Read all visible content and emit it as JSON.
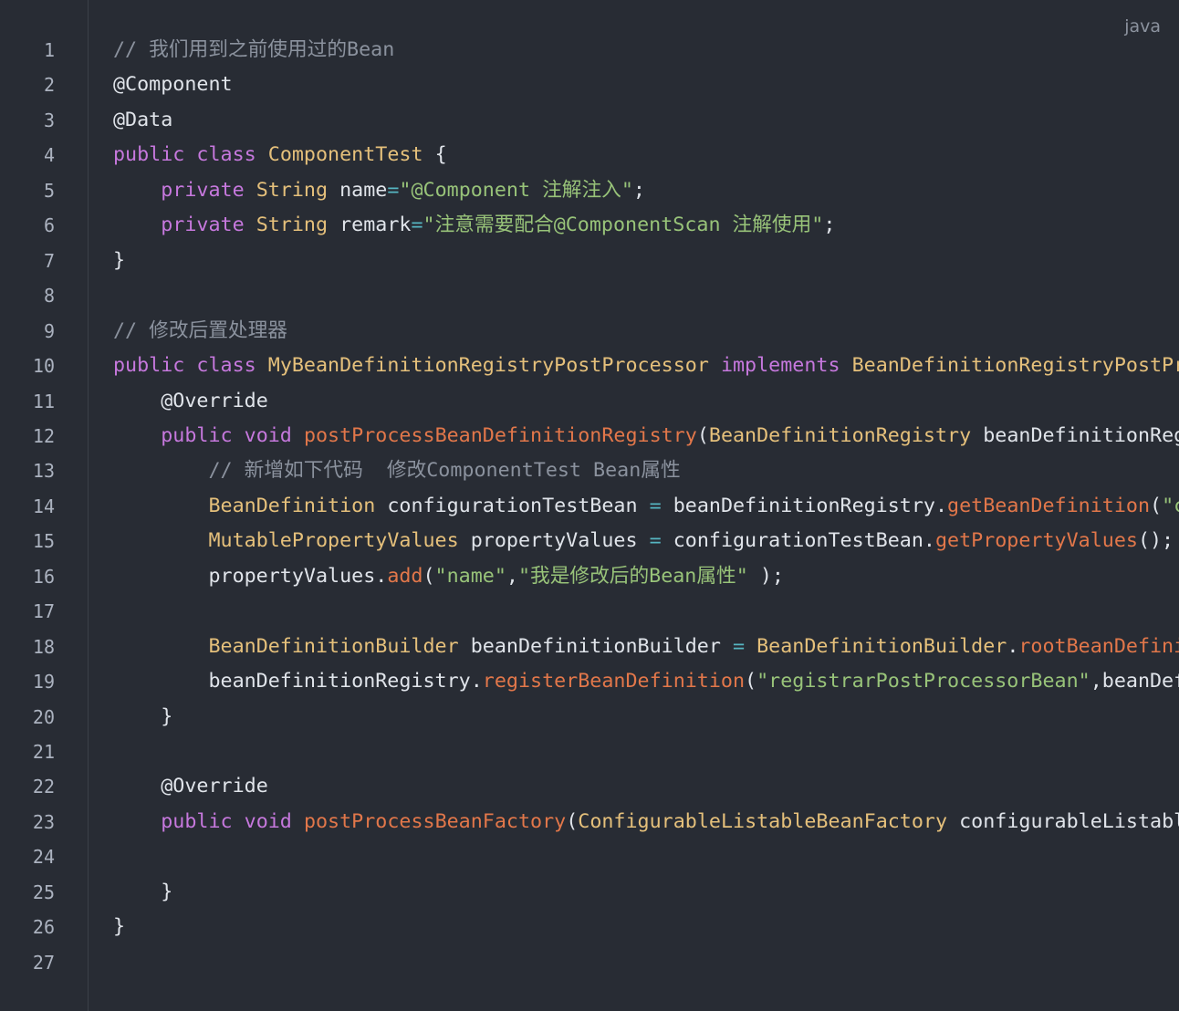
{
  "language_label": "java",
  "colors": {
    "background": "#282c34",
    "comment": "#8b929e",
    "keyword": "#c678dd",
    "class": "#e5c07b",
    "string": "#98c379",
    "function": "#e2774a",
    "operator": "#56b6c2",
    "plain": "#e0e4ea"
  },
  "lines": [
    {
      "num": "1",
      "tokens": [
        {
          "t": "comment",
          "v": "// 我们用到之前使用过的Bean"
        }
      ]
    },
    {
      "num": "2",
      "tokens": [
        {
          "t": "anno",
          "v": "@Component"
        }
      ]
    },
    {
      "num": "3",
      "tokens": [
        {
          "t": "anno",
          "v": "@Data"
        }
      ]
    },
    {
      "num": "4",
      "tokens": [
        {
          "t": "keyword",
          "v": "public"
        },
        {
          "t": "plain",
          "v": " "
        },
        {
          "t": "keyword",
          "v": "class"
        },
        {
          "t": "plain",
          "v": " "
        },
        {
          "t": "class",
          "v": "ComponentTest"
        },
        {
          "t": "plain",
          "v": " {"
        }
      ]
    },
    {
      "num": "5",
      "tokens": [
        {
          "t": "plain",
          "v": "    "
        },
        {
          "t": "keyword",
          "v": "private"
        },
        {
          "t": "plain",
          "v": " "
        },
        {
          "t": "class",
          "v": "String"
        },
        {
          "t": "plain",
          "v": " name"
        },
        {
          "t": "op",
          "v": "="
        },
        {
          "t": "string",
          "v": "\"@Component 注解注入\""
        },
        {
          "t": "plain",
          "v": ";"
        }
      ]
    },
    {
      "num": "6",
      "tokens": [
        {
          "t": "plain",
          "v": "    "
        },
        {
          "t": "keyword",
          "v": "private"
        },
        {
          "t": "plain",
          "v": " "
        },
        {
          "t": "class",
          "v": "String"
        },
        {
          "t": "plain",
          "v": " remark"
        },
        {
          "t": "op",
          "v": "="
        },
        {
          "t": "string",
          "v": "\"注意需要配合@ComponentScan 注解使用\""
        },
        {
          "t": "plain",
          "v": ";"
        }
      ]
    },
    {
      "num": "7",
      "tokens": [
        {
          "t": "plain",
          "v": "}"
        }
      ]
    },
    {
      "num": "8",
      "tokens": []
    },
    {
      "num": "9",
      "tokens": [
        {
          "t": "comment",
          "v": "// 修改后置处理器"
        }
      ]
    },
    {
      "num": "10",
      "tokens": [
        {
          "t": "keyword",
          "v": "public"
        },
        {
          "t": "plain",
          "v": " "
        },
        {
          "t": "keyword",
          "v": "class"
        },
        {
          "t": "plain",
          "v": " "
        },
        {
          "t": "class",
          "v": "MyBeanDefinitionRegistryPostProcessor"
        },
        {
          "t": "plain",
          "v": " "
        },
        {
          "t": "keyword",
          "v": "implements"
        },
        {
          "t": "plain",
          "v": " "
        },
        {
          "t": "class",
          "v": "BeanDefinitionRegistryPostProcessor"
        },
        {
          "t": "plain",
          "v": " {"
        }
      ]
    },
    {
      "num": "11",
      "tokens": [
        {
          "t": "plain",
          "v": "    "
        },
        {
          "t": "anno",
          "v": "@Override"
        }
      ]
    },
    {
      "num": "12",
      "tokens": [
        {
          "t": "plain",
          "v": "    "
        },
        {
          "t": "keyword",
          "v": "public"
        },
        {
          "t": "plain",
          "v": " "
        },
        {
          "t": "keyword",
          "v": "void"
        },
        {
          "t": "plain",
          "v": " "
        },
        {
          "t": "func",
          "v": "postProcessBeanDefinitionRegistry"
        },
        {
          "t": "plain",
          "v": "("
        },
        {
          "t": "class",
          "v": "BeanDefinitionRegistry"
        },
        {
          "t": "plain",
          "v": " beanDefinitionRegistry) {"
        }
      ]
    },
    {
      "num": "13",
      "tokens": [
        {
          "t": "plain",
          "v": "        "
        },
        {
          "t": "comment",
          "v": "// 新增如下代码  修改ComponentTest Bean属性"
        }
      ]
    },
    {
      "num": "14",
      "tokens": [
        {
          "t": "plain",
          "v": "        "
        },
        {
          "t": "class",
          "v": "BeanDefinition"
        },
        {
          "t": "plain",
          "v": " configurationTestBean "
        },
        {
          "t": "op",
          "v": "="
        },
        {
          "t": "plain",
          "v": " beanDefinitionRegistry."
        },
        {
          "t": "func",
          "v": "getBeanDefinition"
        },
        {
          "t": "plain",
          "v": "("
        },
        {
          "t": "string",
          "v": "\"componentTest\""
        },
        {
          "t": "plain",
          "v": ");"
        }
      ]
    },
    {
      "num": "15",
      "tokens": [
        {
          "t": "plain",
          "v": "        "
        },
        {
          "t": "class",
          "v": "MutablePropertyValues"
        },
        {
          "t": "plain",
          "v": " propertyValues "
        },
        {
          "t": "op",
          "v": "="
        },
        {
          "t": "plain",
          "v": " configurationTestBean."
        },
        {
          "t": "func",
          "v": "getPropertyValues"
        },
        {
          "t": "plain",
          "v": "();"
        }
      ]
    },
    {
      "num": "16",
      "tokens": [
        {
          "t": "plain",
          "v": "        propertyValues."
        },
        {
          "t": "func",
          "v": "add"
        },
        {
          "t": "plain",
          "v": "("
        },
        {
          "t": "string",
          "v": "\"name\""
        },
        {
          "t": "plain",
          "v": ","
        },
        {
          "t": "string",
          "v": "\"我是修改后的Bean属性\""
        },
        {
          "t": "plain",
          "v": " );"
        }
      ]
    },
    {
      "num": "17",
      "tokens": []
    },
    {
      "num": "18",
      "tokens": [
        {
          "t": "plain",
          "v": "        "
        },
        {
          "t": "class",
          "v": "BeanDefinitionBuilder"
        },
        {
          "t": "plain",
          "v": " beanDefinitionBuilder "
        },
        {
          "t": "op",
          "v": "="
        },
        {
          "t": "plain",
          "v": " "
        },
        {
          "t": "class",
          "v": "BeanDefinitionBuilder"
        },
        {
          "t": "plain",
          "v": "."
        },
        {
          "t": "func",
          "v": "rootBeanDefinition"
        },
        {
          "t": "plain",
          "v": "("
        }
      ]
    },
    {
      "num": "19",
      "tokens": [
        {
          "t": "plain",
          "v": "        beanDefinitionRegistry."
        },
        {
          "t": "func",
          "v": "registerBeanDefinition"
        },
        {
          "t": "plain",
          "v": "("
        },
        {
          "t": "string",
          "v": "\"registrarPostProcessorBean\""
        },
        {
          "t": "plain",
          "v": ",beanDefinitionBuilder"
        }
      ]
    },
    {
      "num": "20",
      "tokens": [
        {
          "t": "plain",
          "v": "    }"
        }
      ]
    },
    {
      "num": "21",
      "tokens": []
    },
    {
      "num": "22",
      "tokens": [
        {
          "t": "plain",
          "v": "    "
        },
        {
          "t": "anno",
          "v": "@Override"
        }
      ]
    },
    {
      "num": "23",
      "tokens": [
        {
          "t": "plain",
          "v": "    "
        },
        {
          "t": "keyword",
          "v": "public"
        },
        {
          "t": "plain",
          "v": " "
        },
        {
          "t": "keyword",
          "v": "void"
        },
        {
          "t": "plain",
          "v": " "
        },
        {
          "t": "func",
          "v": "postProcessBeanFactory"
        },
        {
          "t": "plain",
          "v": "("
        },
        {
          "t": "class",
          "v": "ConfigurableListableBeanFactory"
        },
        {
          "t": "plain",
          "v": " configurableListableBeanFactory) {"
        }
      ]
    },
    {
      "num": "24",
      "tokens": []
    },
    {
      "num": "25",
      "tokens": [
        {
          "t": "plain",
          "v": "    }"
        }
      ]
    },
    {
      "num": "26",
      "tokens": [
        {
          "t": "plain",
          "v": "}"
        }
      ]
    },
    {
      "num": "27",
      "tokens": []
    }
  ]
}
